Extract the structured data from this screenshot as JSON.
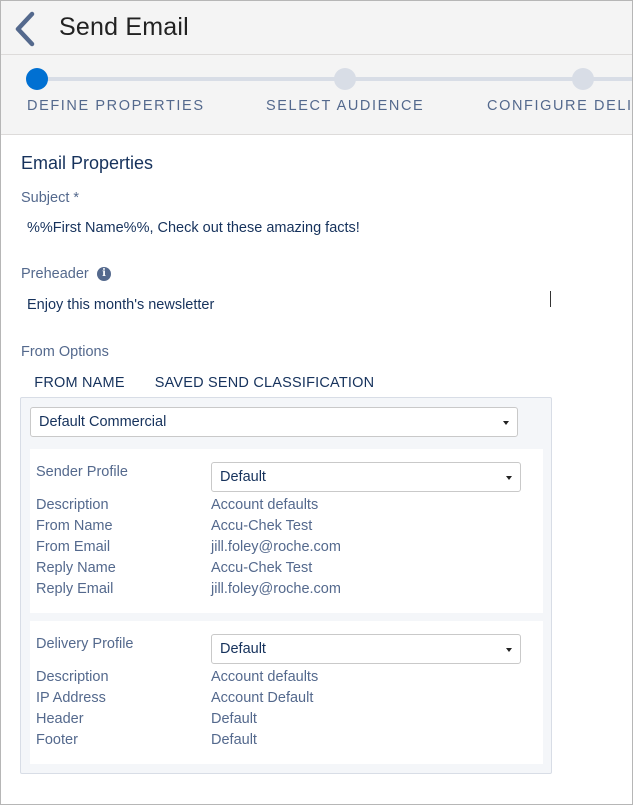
{
  "header": {
    "title": "Send Email",
    "back_icon": "chevron-left-icon"
  },
  "wizard": {
    "steps": [
      {
        "label": "DEFINE PROPERTIES",
        "active": true
      },
      {
        "label": "SELECT AUDIENCE",
        "active": false
      },
      {
        "label": "CONFIGURE DELIVERY",
        "active": false
      }
    ],
    "active_color": "#0070d2"
  },
  "email_properties": {
    "section_title": "Email Properties",
    "subject_label": "Subject *",
    "subject_value": "%%First Name%%, Check out these amazing facts!",
    "preheader_label": "Preheader",
    "preheader_info_icon": "info-icon",
    "preheader_value": "Enjoy this month's newsletter"
  },
  "from_options": {
    "label": "From Options",
    "tabs": [
      {
        "label": "FROM NAME",
        "active": false
      },
      {
        "label": "SAVED SEND CLASSIFICATION",
        "active": true
      }
    ],
    "classification_select": "Default Commercial",
    "sender_profile": {
      "label": "Sender Profile",
      "select_value": "Default",
      "rows": [
        {
          "label": "Description",
          "value": "Account defaults"
        },
        {
          "label": "From Name",
          "value": "Accu-Chek Test"
        },
        {
          "label": "From Email",
          "value": "jill.foley@roche.com"
        },
        {
          "label": "Reply Name",
          "value": "Accu-Chek Test"
        },
        {
          "label": "Reply Email",
          "value": "jill.foley@roche.com"
        }
      ]
    },
    "delivery_profile": {
      "label": "Delivery Profile",
      "select_value": "Default",
      "rows": [
        {
          "label": "Description",
          "value": "Account defaults"
        },
        {
          "label": "IP Address",
          "value": "Account Default"
        },
        {
          "label": "Header",
          "value": "Default"
        },
        {
          "label": "Footer",
          "value": "Default"
        }
      ]
    }
  }
}
